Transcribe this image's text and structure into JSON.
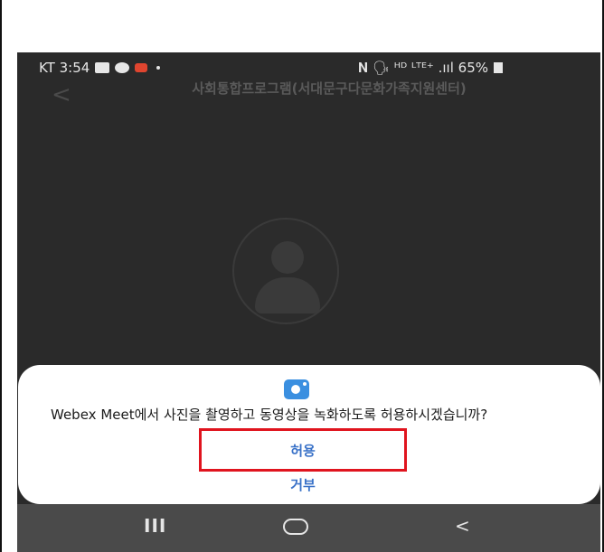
{
  "status_bar": {
    "left_text": "KT 3:54",
    "right_text": "𝐍 🗣 ᴴᴰ ᴸᵀᴱ⁺ .ııl 65%"
  },
  "header": {
    "back_label": "<",
    "title": "사회통합프로그램(서대문구다문화가족지원센터)"
  },
  "dialog": {
    "message": "Webex Meet에서 사진을 촬영하고 동영상을 녹화하도록 허용하시겠습니까?",
    "allow_label": "허용",
    "deny_label": "거부"
  },
  "nav": {
    "recents": "III",
    "back": "<"
  },
  "colors": {
    "accent": "#3a72c8",
    "highlight_border": "#e0141e",
    "background": "#2a2a2a",
    "camera_icon": "#3a8fe0"
  }
}
